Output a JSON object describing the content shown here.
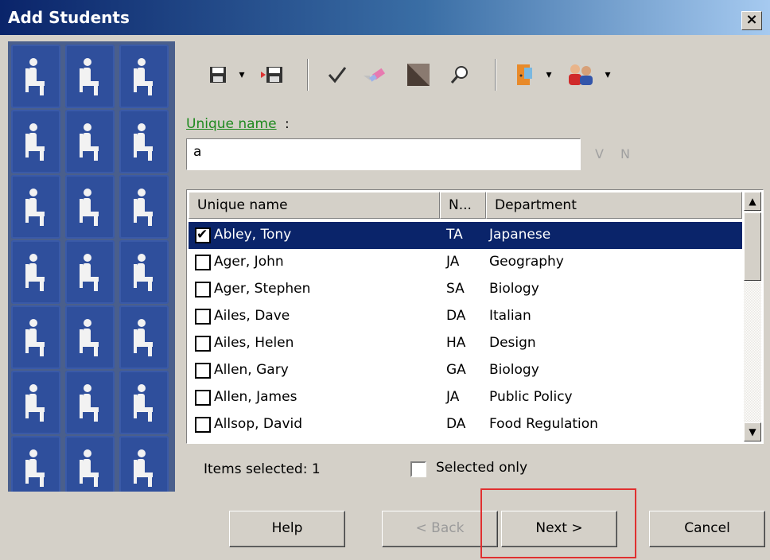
{
  "window": {
    "title": "Add Students",
    "close_label": "×"
  },
  "toolbar": {
    "icons": [
      "save-icon",
      "save-as-icon",
      "check-icon",
      "eraser-icon",
      "triangle-icon",
      "search-icon",
      "door-icon",
      "users-icon"
    ]
  },
  "filter": {
    "label": "Unique name",
    "label_suffix": ":",
    "value": "a",
    "hint": "V N"
  },
  "table": {
    "columns": [
      "Unique name",
      "N...",
      "Department"
    ],
    "rows": [
      {
        "name": "Abley, Tony",
        "initials": "TA",
        "department": "Japanese",
        "checked": true,
        "selected": true
      },
      {
        "name": "Ager, John",
        "initials": "JA",
        "department": "Geography",
        "checked": false,
        "selected": false
      },
      {
        "name": "Ager, Stephen",
        "initials": "SA",
        "department": "Biology",
        "checked": false,
        "selected": false
      },
      {
        "name": "Ailes, Dave",
        "initials": "DA",
        "department": "Italian",
        "checked": false,
        "selected": false
      },
      {
        "name": "Ailes, Helen",
        "initials": "HA",
        "department": "Design",
        "checked": false,
        "selected": false
      },
      {
        "name": "Allen, Gary",
        "initials": "GA",
        "department": "Biology",
        "checked": false,
        "selected": false
      },
      {
        "name": "Allen, James",
        "initials": "JA",
        "department": "Public Policy",
        "checked": false,
        "selected": false
      },
      {
        "name": "Allsop, David",
        "initials": "DA",
        "department": "Food Regulation",
        "checked": false,
        "selected": false
      }
    ]
  },
  "status": {
    "items_selected": "Items selected: 1",
    "selected_only_label": "Selected only"
  },
  "buttons": {
    "help": "Help",
    "back": "< Back",
    "next": "Next >",
    "cancel": "Cancel"
  },
  "colors": {
    "selection": "#0a246a",
    "label_link": "#1f8a1f",
    "highlight_box": "#e03030"
  }
}
